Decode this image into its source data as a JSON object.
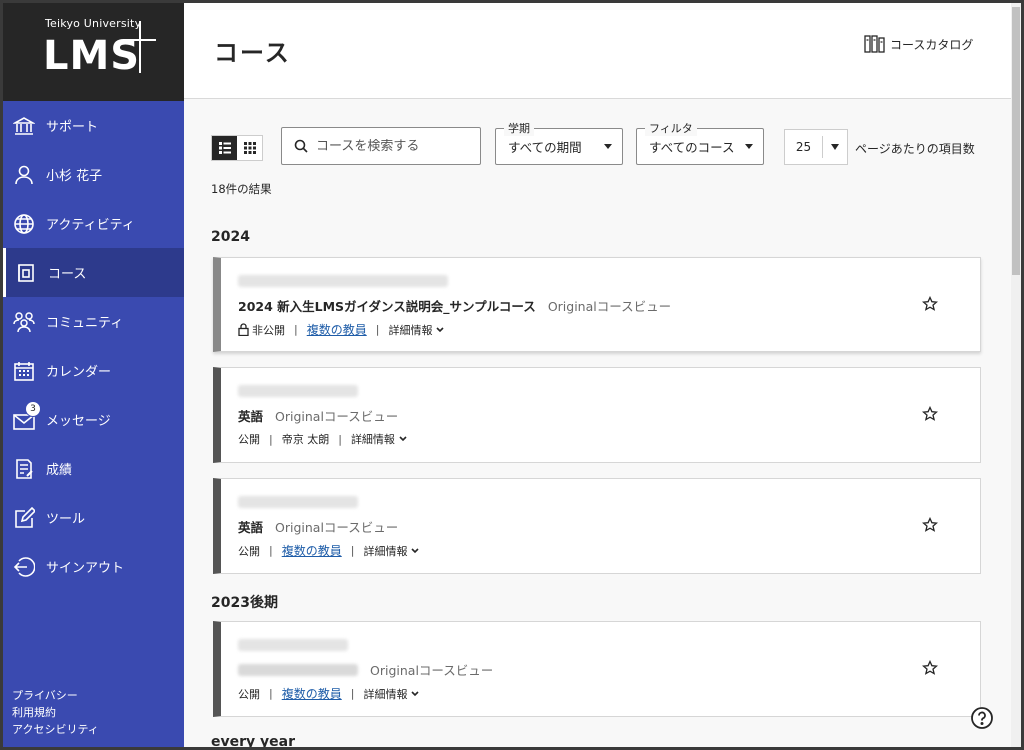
{
  "brand": {
    "university": "Teikyo University",
    "product": "LMS"
  },
  "sidebar": {
    "items": [
      {
        "label": "サポート",
        "icon": "bank-icon",
        "active": false
      },
      {
        "label": "小杉 花子",
        "icon": "user-icon",
        "active": false
      },
      {
        "label": "アクティビティ",
        "icon": "globe-icon",
        "active": false
      },
      {
        "label": "コース",
        "icon": "course-icon",
        "active": true
      },
      {
        "label": "コミュニティ",
        "icon": "community-icon",
        "active": false
      },
      {
        "label": "カレンダー",
        "icon": "calendar-icon",
        "active": false
      },
      {
        "label": "メッセージ",
        "icon": "mail-icon",
        "active": false,
        "badge": "3"
      },
      {
        "label": "成績",
        "icon": "grades-icon",
        "active": false
      },
      {
        "label": "ツール",
        "icon": "tools-icon",
        "active": false
      },
      {
        "label": "サインアウト",
        "icon": "signout-icon",
        "active": false
      }
    ],
    "footer": [
      "プライバシー",
      "利用規約",
      "アクセシビリティ"
    ]
  },
  "header": {
    "title": "コース",
    "catalog_label": "コースカタログ"
  },
  "toolbar": {
    "search_placeholder": "コースを検索する",
    "term_label": "学期",
    "term_value": "すべての期間",
    "filter_label": "フィルタ",
    "filter_value": "すべてのコース",
    "per_page_value": "25",
    "per_page_label": "ページあたりの項目数"
  },
  "results_count": "18件の結果",
  "groups": [
    {
      "year": "2024",
      "courses": [
        {
          "title": "2024 新入生LMSガイダンス説明会_サンプルコース",
          "view_type": "Originalコースビュー",
          "status": "非公開",
          "private": true,
          "instructor": "複数の教員",
          "instructor_link": true,
          "details": "詳細情報"
        },
        {
          "title": "英語",
          "view_type": "Originalコースビュー",
          "status": "公開",
          "private": false,
          "instructor": "帝京 太朗",
          "instructor_link": false,
          "details": "詳細情報"
        },
        {
          "title": "英語",
          "view_type": "Originalコースビュー",
          "status": "公開",
          "private": false,
          "instructor": "複数の教員",
          "instructor_link": true,
          "details": "詳細情報"
        }
      ]
    },
    {
      "year": "2023後期",
      "courses": [
        {
          "title": "",
          "view_type": "Originalコースビュー",
          "status": "公開",
          "private": false,
          "instructor": "複数の教員",
          "instructor_link": true,
          "details": "詳細情報"
        }
      ]
    },
    {
      "year": "every year",
      "courses": []
    }
  ]
}
